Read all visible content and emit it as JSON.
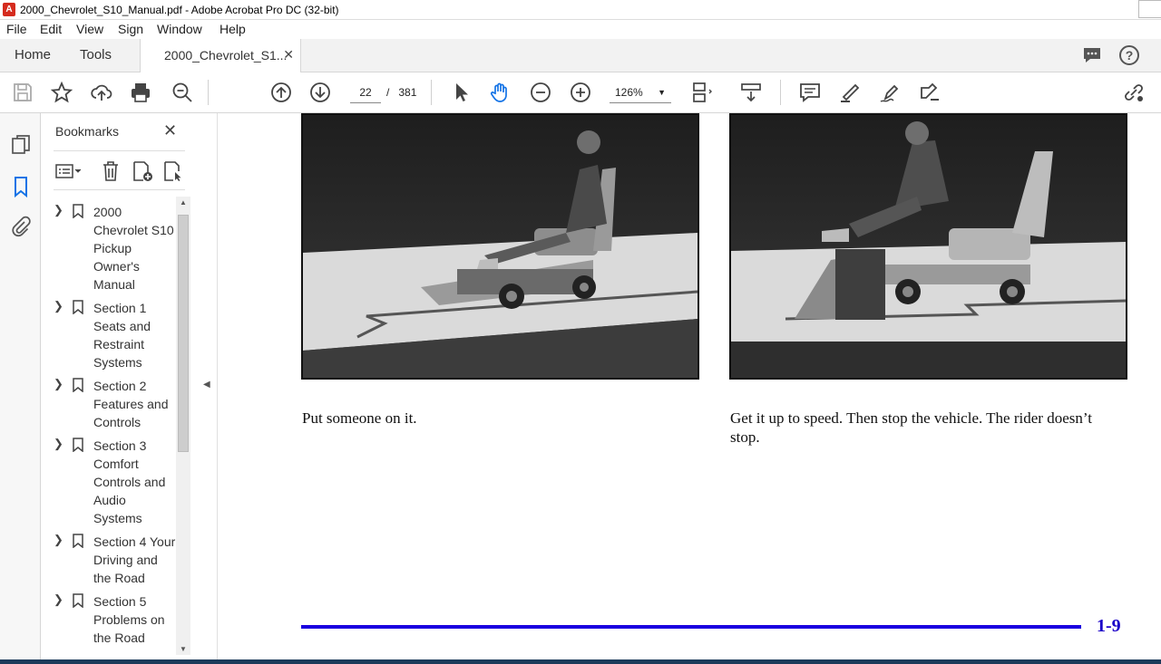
{
  "window": {
    "title": "2000_Chevrolet_S10_Manual.pdf - Adobe Acrobat Pro DC (32-bit)"
  },
  "menu": [
    "File",
    "Edit",
    "View",
    "Sign",
    "Window",
    "Help"
  ],
  "tabs": {
    "home": "Home",
    "tools": "Tools",
    "document": "2000_Chevrolet_S1..."
  },
  "toolbar": {
    "current_page": "22",
    "page_separator": "/",
    "total_pages": "381",
    "zoom": "126%"
  },
  "bookmarks": {
    "title": "Bookmarks",
    "items": [
      {
        "label": "2000 Chevrolet S10 Pickup Owner's Manual"
      },
      {
        "label": "Section 1 Seats and Restraint Systems"
      },
      {
        "label": "Section 2 Features and Controls"
      },
      {
        "label": "Section 3 Comfort Controls and Audio Systems"
      },
      {
        "label": "Section 4 Your Driving and the Road"
      },
      {
        "label": "Section 5 Problems on the Road"
      }
    ]
  },
  "page": {
    "caption_left": "Put someone on it.",
    "caption_right": "Get it up to speed. Then stop the vehicle. The rider doesn’t stop.",
    "page_number": "1-9"
  },
  "colors": {
    "accent": "#1a00e0",
    "acrobat_red": "#d52b1e",
    "icon_blue": "#1473e6"
  }
}
